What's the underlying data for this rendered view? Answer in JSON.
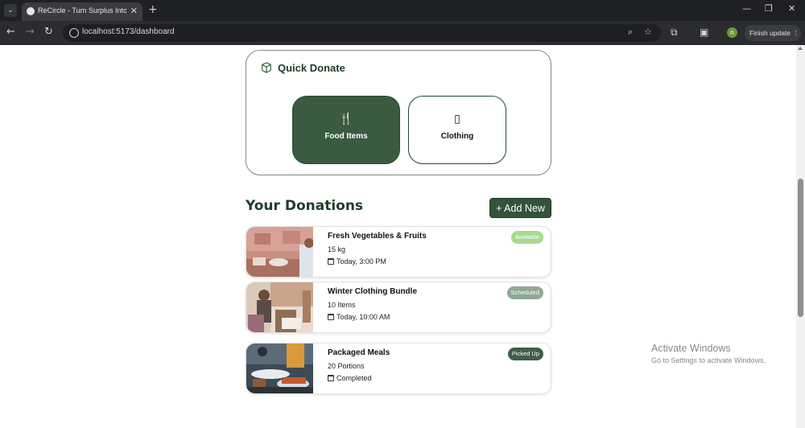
{
  "browser": {
    "tab_title": "ReCircle - Turn Surplus Into Su",
    "url": "localhost:5173/dashboard",
    "finish_update_label": "Finish update",
    "profile_initial": "n"
  },
  "quick_donate": {
    "title": "Quick Donate",
    "categories": [
      {
        "label": "Food Items",
        "icon": "utensils-icon",
        "glyph": "🍴"
      },
      {
        "label": "Clothing",
        "icon": "shirt-icon",
        "glyph": "▯"
      }
    ]
  },
  "donations": {
    "title": "Your Donations",
    "add_new_label": "+ Add New",
    "items": [
      {
        "title": "Fresh Vegetables & Fruits",
        "quantity": "15 kg",
        "when": "Today, 3:00 PM",
        "status": "Available",
        "status_color": "#a9d98f"
      },
      {
        "title": "Winter Clothing Bundle",
        "quantity": "10 Items",
        "when": "Today, 10:00 AM",
        "status": "Scheduled",
        "status_color": "#8fa895"
      },
      {
        "title": "Packaged Meals",
        "quantity": "20 Portions",
        "when": "Completed",
        "status": "Picked Up",
        "status_color": "#3f5e48"
      }
    ]
  },
  "os_watermark": {
    "title": "Activate Windows",
    "subtitle": "Go to Settings to activate Windows."
  },
  "colors": {
    "accent": "#3a5b40",
    "heading": "#1f3d2a"
  }
}
